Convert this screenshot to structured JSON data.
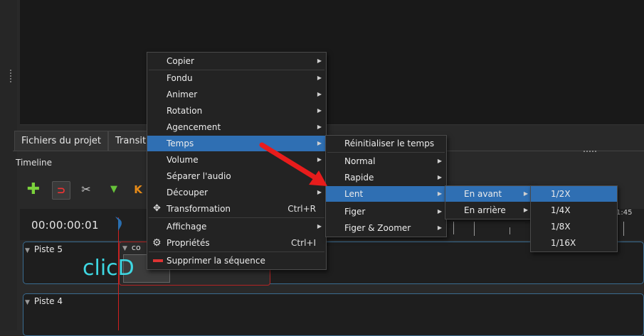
{
  "tabs": {
    "project_files": "Fichiers du projet",
    "transitions": "Transiti"
  },
  "timeline": {
    "title": "Timeline",
    "timecode": "00:00:00:01",
    "ruler_label": "1:45"
  },
  "tracks": [
    {
      "name": "Piste 5"
    },
    {
      "name": "Piste 4"
    }
  ],
  "clip": {
    "title": "co",
    "overlay_text": "clicD"
  },
  "context_menu": {
    "items": [
      {
        "label": "Copier",
        "submenu": true
      },
      {
        "label": "Fondu",
        "submenu": true
      },
      {
        "label": "Animer",
        "submenu": true
      },
      {
        "label": "Rotation",
        "submenu": true
      },
      {
        "label": "Agencement",
        "submenu": true
      },
      {
        "label": "Temps",
        "submenu": true,
        "highlighted": true
      },
      {
        "label": "Volume",
        "submenu": true
      },
      {
        "label": "Séparer l'audio",
        "submenu": false
      },
      {
        "label": "Découper",
        "submenu": true
      },
      {
        "label": "Transformation",
        "shortcut": "Ctrl+R",
        "icon": "move-icon"
      },
      {
        "label": "Affichage",
        "submenu": true
      },
      {
        "label": "Propriétés",
        "shortcut": "Ctrl+I",
        "icon": "gear-icon"
      },
      {
        "label": "Supprimer la séquence",
        "icon": "delete-icon"
      }
    ]
  },
  "temps_menu": {
    "items": [
      {
        "label": "Réinitialiser le temps"
      },
      {
        "label": "Normal",
        "submenu": true
      },
      {
        "label": "Rapide",
        "submenu": true
      },
      {
        "label": "Lent",
        "submenu": true,
        "highlighted": true
      },
      {
        "label": "Figer",
        "submenu": true
      },
      {
        "label": "Figer & Zoomer",
        "submenu": true
      }
    ]
  },
  "lent_menu": {
    "items": [
      {
        "label": "En avant",
        "submenu": true,
        "highlighted": true
      },
      {
        "label": "En arrière",
        "submenu": true
      }
    ]
  },
  "en_avant_menu": {
    "items": [
      {
        "label": "1/2X",
        "highlighted": true
      },
      {
        "label": "1/4X"
      },
      {
        "label": "1/8X"
      },
      {
        "label": "1/16X"
      }
    ]
  },
  "colors": {
    "highlight": "#2f6fb3",
    "track_border": "#3a6c91",
    "playhead": "#d02020",
    "annotation_arrow": "#e81c1c"
  }
}
